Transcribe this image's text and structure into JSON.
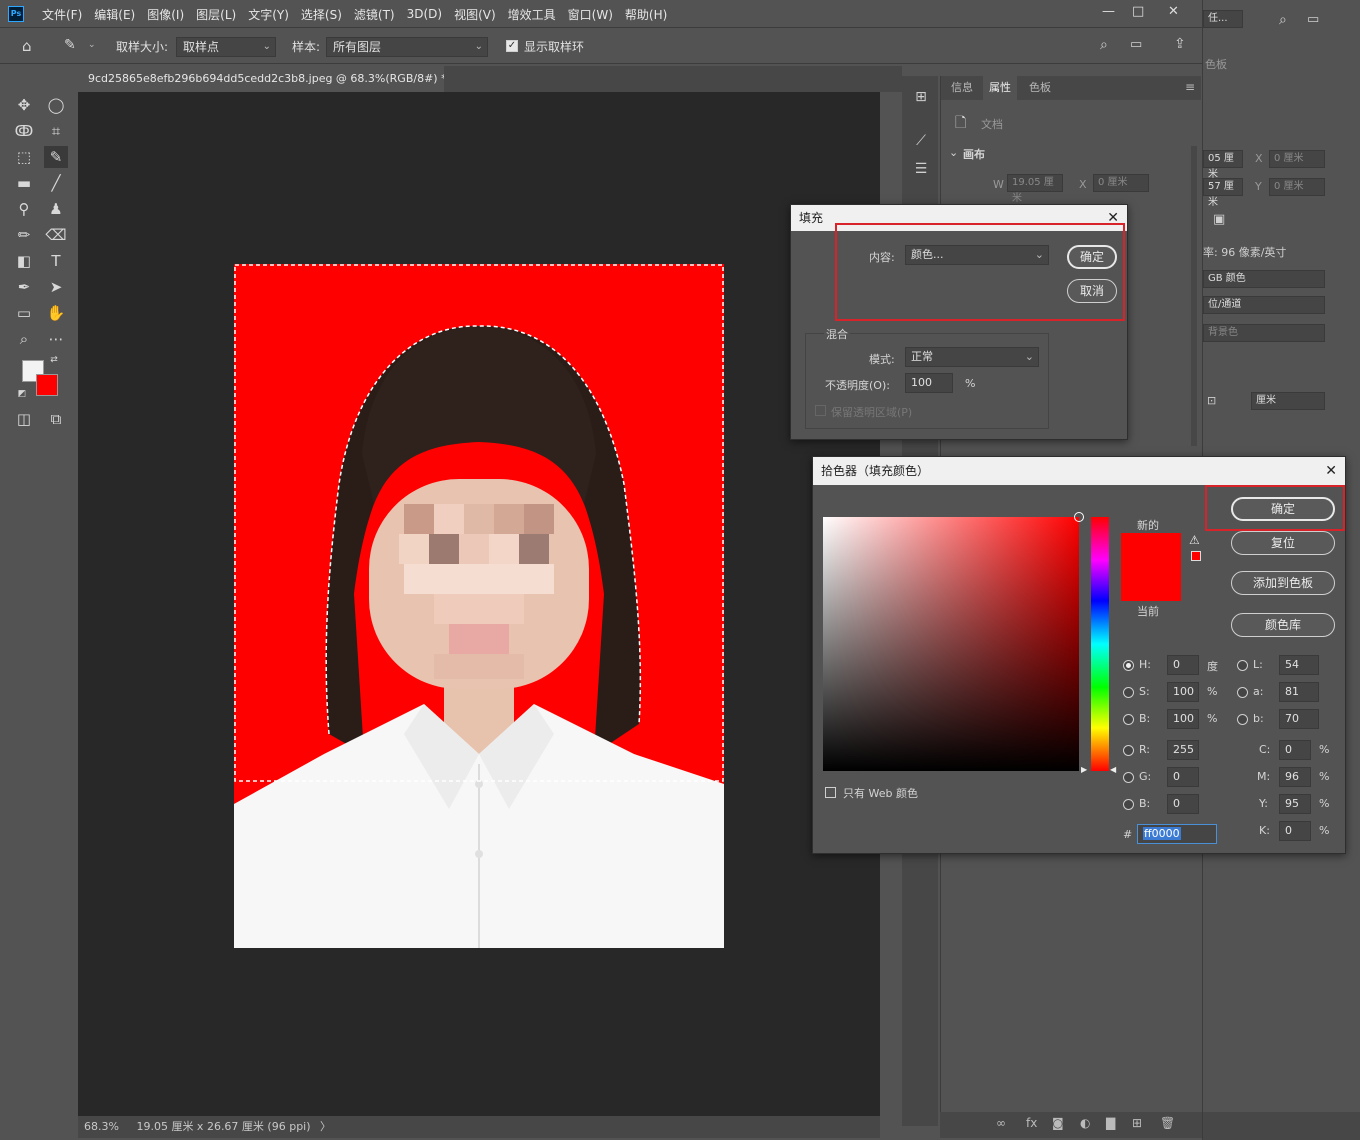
{
  "menubar": {
    "logo": "Ps",
    "items": [
      "文件(F)",
      "编辑(E)",
      "图像(I)",
      "图层(L)",
      "文字(Y)",
      "选择(S)",
      "滤镜(T)",
      "3D(D)",
      "视图(V)",
      "增效工具",
      "窗口(W)",
      "帮助(H)"
    ],
    "minimize": "—",
    "maximize": "□",
    "close": "✕"
  },
  "options": {
    "sample_size_label": "取样大小:",
    "sample_size_value": "取样点",
    "sample_label": "样本:",
    "sample_value": "所有图层",
    "show_ring_label": "显示取样环"
  },
  "document": {
    "tab_title": "9cd25865e8efb296b694dd5cedd2c3b8.jpeg @ 68.3%(RGB/8#) *",
    "tab_close": "×"
  },
  "status": {
    "zoom": "68.3%",
    "size": "19.05 厘米 x 26.67 厘米 (96 ppi)",
    "arrow": "〉"
  },
  "props_panel": {
    "tabs": [
      "信息",
      "属性",
      "色板"
    ],
    "doc_label": "文档",
    "canvas_label": "画布",
    "w_label": "W",
    "w_value": "19.05 厘米",
    "x_label": "X",
    "x_value": "0 厘米"
  },
  "right_column": {
    "top_field": "任...",
    "panel_label": "色板",
    "f1": "05 厘米",
    "f1x": "X",
    "f1xv": "0 厘米",
    "f2": "57 厘米",
    "f2y": "Y",
    "f2yv": "0 厘米",
    "resolution": "率: 96 像素/英寸",
    "mode": "GB 颜色",
    "depth": "位/通道",
    "bg": "背景色",
    "unit": "厘米"
  },
  "fill_dialog": {
    "title": "填充",
    "content_label": "内容:",
    "content_value": "颜色...",
    "ok": "确定",
    "cancel": "取消",
    "blend_label": "混合",
    "mode_label": "模式:",
    "mode_value": "正常",
    "opacity_label": "不透明度(O):",
    "opacity_value": "100",
    "opacity_unit": "%",
    "preserve_label": "保留透明区域(P)"
  },
  "color_picker": {
    "title": "拾色器（填充颜色）",
    "new_label": "新的",
    "current_label": "当前",
    "ok": "确定",
    "reset": "复位",
    "add_swatch": "添加到色板",
    "color_lib": "颜色库",
    "web_only": "只有 Web 颜色",
    "hex_label": "#",
    "hex_value": "ff0000",
    "new_color": "#ff0000",
    "current_color": "#ff0000",
    "fields": {
      "H": {
        "label": "H:",
        "value": "0",
        "unit": "度"
      },
      "S": {
        "label": "S:",
        "value": "100",
        "unit": "%"
      },
      "B": {
        "label": "B:",
        "value": "100",
        "unit": "%"
      },
      "R": {
        "label": "R:",
        "value": "255"
      },
      "G": {
        "label": "G:",
        "value": "0"
      },
      "Bb": {
        "label": "B:",
        "value": "0"
      },
      "L": {
        "label": "L:",
        "value": "54"
      },
      "a": {
        "label": "a:",
        "value": "81"
      },
      "b": {
        "label": "b:",
        "value": "70"
      },
      "C": {
        "label": "C:",
        "value": "0",
        "unit": "%"
      },
      "M": {
        "label": "M:",
        "value": "96",
        "unit": "%"
      },
      "Y": {
        "label": "Y:",
        "value": "95",
        "unit": "%"
      },
      "K": {
        "label": "K:",
        "value": "0",
        "unit": "%"
      }
    }
  },
  "colors": {
    "foreground": "#f3f3f3",
    "background": "#ff0000",
    "highlight": "#d8232a"
  }
}
